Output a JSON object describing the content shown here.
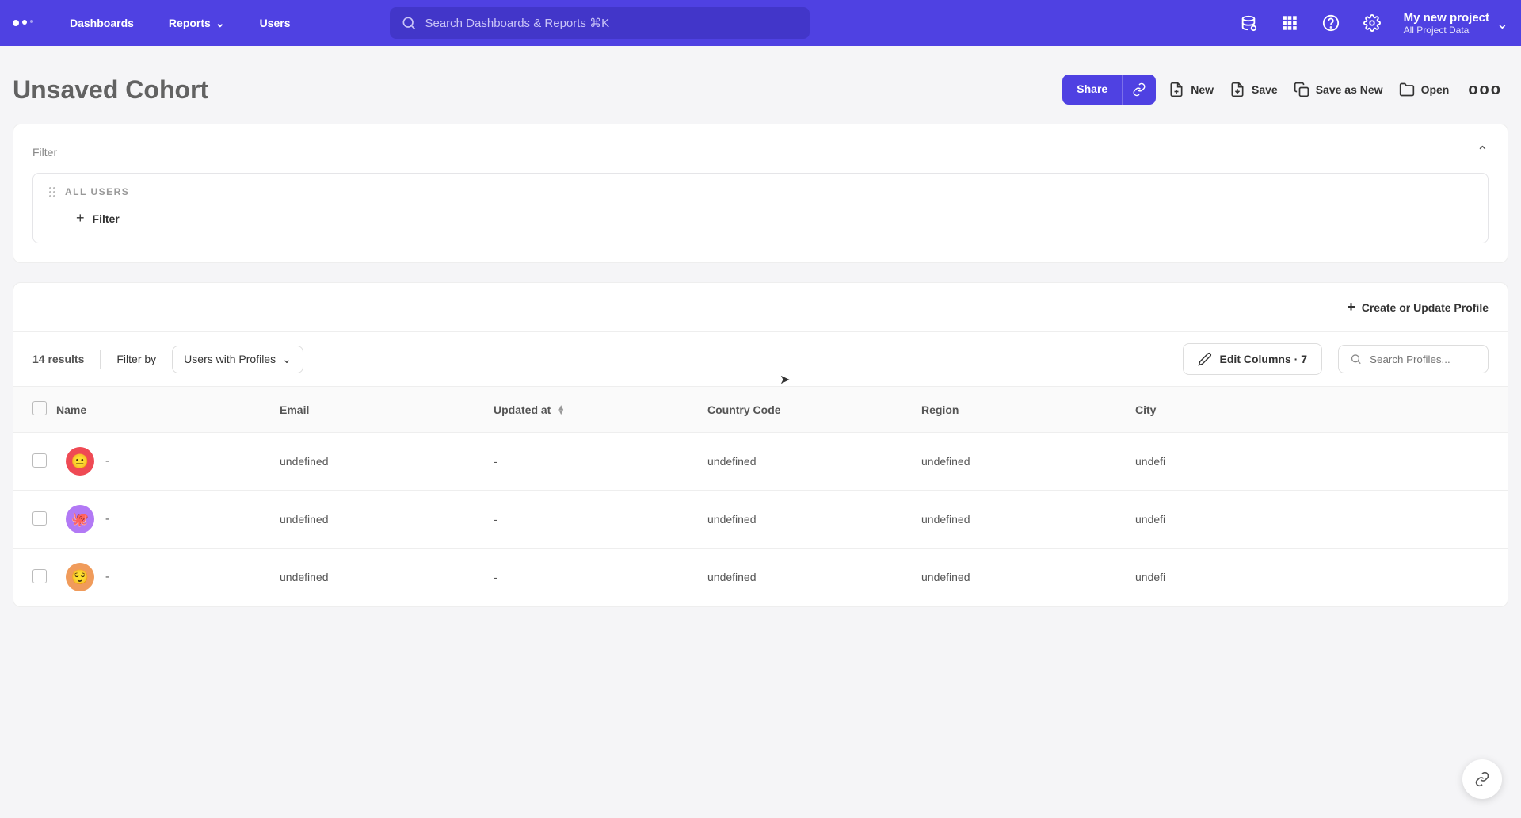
{
  "nav": {
    "dashboards": "Dashboards",
    "reports": "Reports",
    "users": "Users",
    "search_placeholder": "Search Dashboards & Reports ⌘K",
    "project_name": "My new project",
    "project_sub": "All Project Data"
  },
  "header": {
    "title": "Unsaved Cohort",
    "share": "Share",
    "new": "New",
    "save": "Save",
    "save_as_new": "Save as New",
    "open": "Open"
  },
  "filter": {
    "label": "Filter",
    "all_users": "ALL USERS",
    "add": "Filter"
  },
  "results": {
    "create_profile": "Create or Update Profile",
    "count": "14 results",
    "filter_by": "Filter by",
    "dropdown": "Users with Profiles",
    "edit_columns": "Edit Columns · 7",
    "search_placeholder": "Search Profiles..."
  },
  "table": {
    "cols": {
      "name": "Name",
      "email": "Email",
      "updated": "Updated at",
      "country": "Country Code",
      "region": "Region",
      "city": "City"
    },
    "rows": [
      {
        "avatar": "av-red",
        "face": "😐",
        "name": "-",
        "email": "undefined",
        "updated": "-",
        "country": "undefined",
        "region": "undefined",
        "city": "undefi"
      },
      {
        "avatar": "av-purple",
        "face": "🐙",
        "name": "-",
        "email": "undefined",
        "updated": "-",
        "country": "undefined",
        "region": "undefined",
        "city": "undefi"
      },
      {
        "avatar": "av-orange",
        "face": "😌",
        "name": "-",
        "email": "undefined",
        "updated": "-",
        "country": "undefined",
        "region": "undefined",
        "city": "undefi"
      }
    ]
  }
}
